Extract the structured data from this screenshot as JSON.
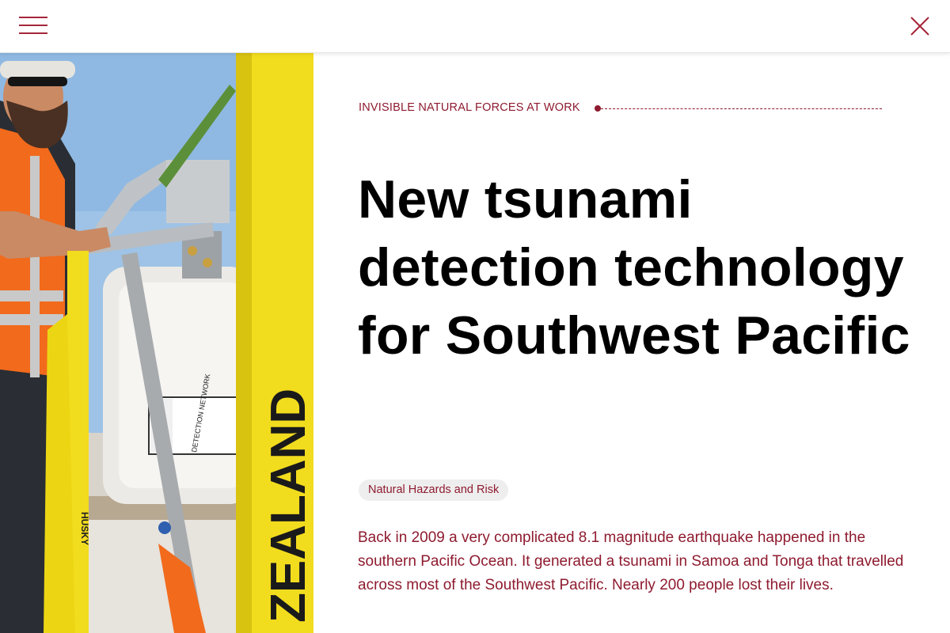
{
  "header": {
    "menu_icon": "hamburger-menu-icon",
    "close_icon": "close-x-icon",
    "accent_color": "#a6263a"
  },
  "article": {
    "eyebrow": "INVISIBLE NATURAL FORCES AT WORK",
    "title": "New tsunami detection technology for Southwest Pacific",
    "tag": "Natural Hazards and Risk",
    "intro": "Back in 2009 a very complicated 8.1 magnitude earthquake happened in the southern Pacific Ocean. It generated a tsunami in Samoa and Tonga that travelled across most of the Southwest Pacific. Nearly 200 people lost their lives.",
    "text_color": "#8e1b2f"
  },
  "photo": {
    "buoy_text": "ZEALAND",
    "label_text": "DETECTION NETWORK",
    "strap_text": "HUSKY"
  }
}
